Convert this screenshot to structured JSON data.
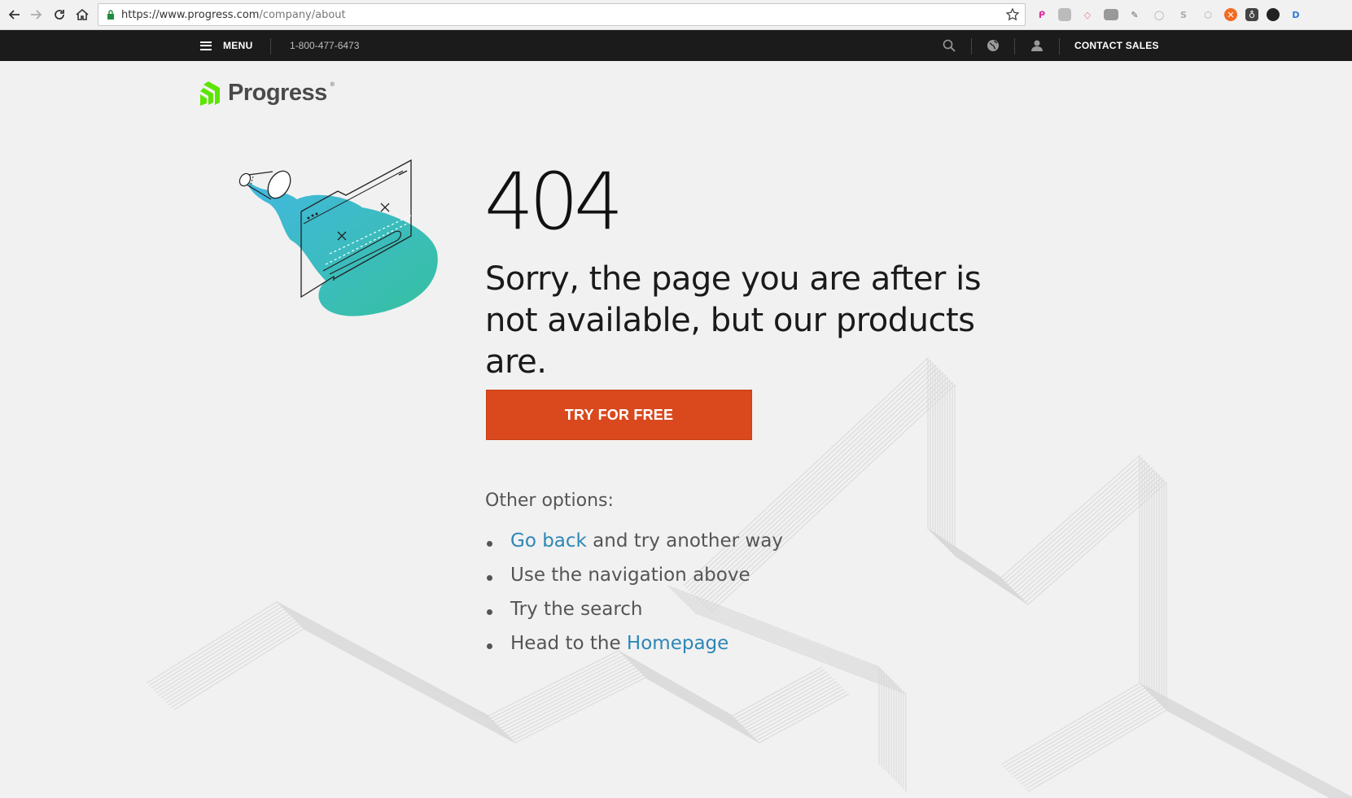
{
  "browser": {
    "url_host": "https://www.progress.com",
    "url_path": "/company/about"
  },
  "topbar": {
    "menu_label": "MENU",
    "phone": "1-800-477-6473",
    "contact_label": "CONTACT SALES"
  },
  "logo": {
    "text": "Progress",
    "reg": "®"
  },
  "main": {
    "code": "404",
    "headline": "Sorry, the page you are after is not available, but our products are.",
    "cta_label": "TRY FOR FREE",
    "other_title": "Other options:",
    "options": [
      {
        "link": "Go back",
        "text": " and try another way"
      },
      {
        "text": "Use the navigation above"
      },
      {
        "text": "Try the search"
      },
      {
        "text": "Head to the ",
        "link": "Homepage"
      }
    ]
  },
  "colors": {
    "accent": "#d9491d",
    "link": "#2d86b5",
    "topbar": "#1b1b1b",
    "brand_green": "#5ce500"
  },
  "icons": {
    "back": "back-arrow-icon",
    "forward": "forward-arrow-icon",
    "reload": "reload-icon",
    "home": "home-icon",
    "star": "star-icon",
    "menu": "hamburger-icon",
    "search": "search-icon",
    "globe": "globe-icon",
    "user": "user-icon"
  }
}
